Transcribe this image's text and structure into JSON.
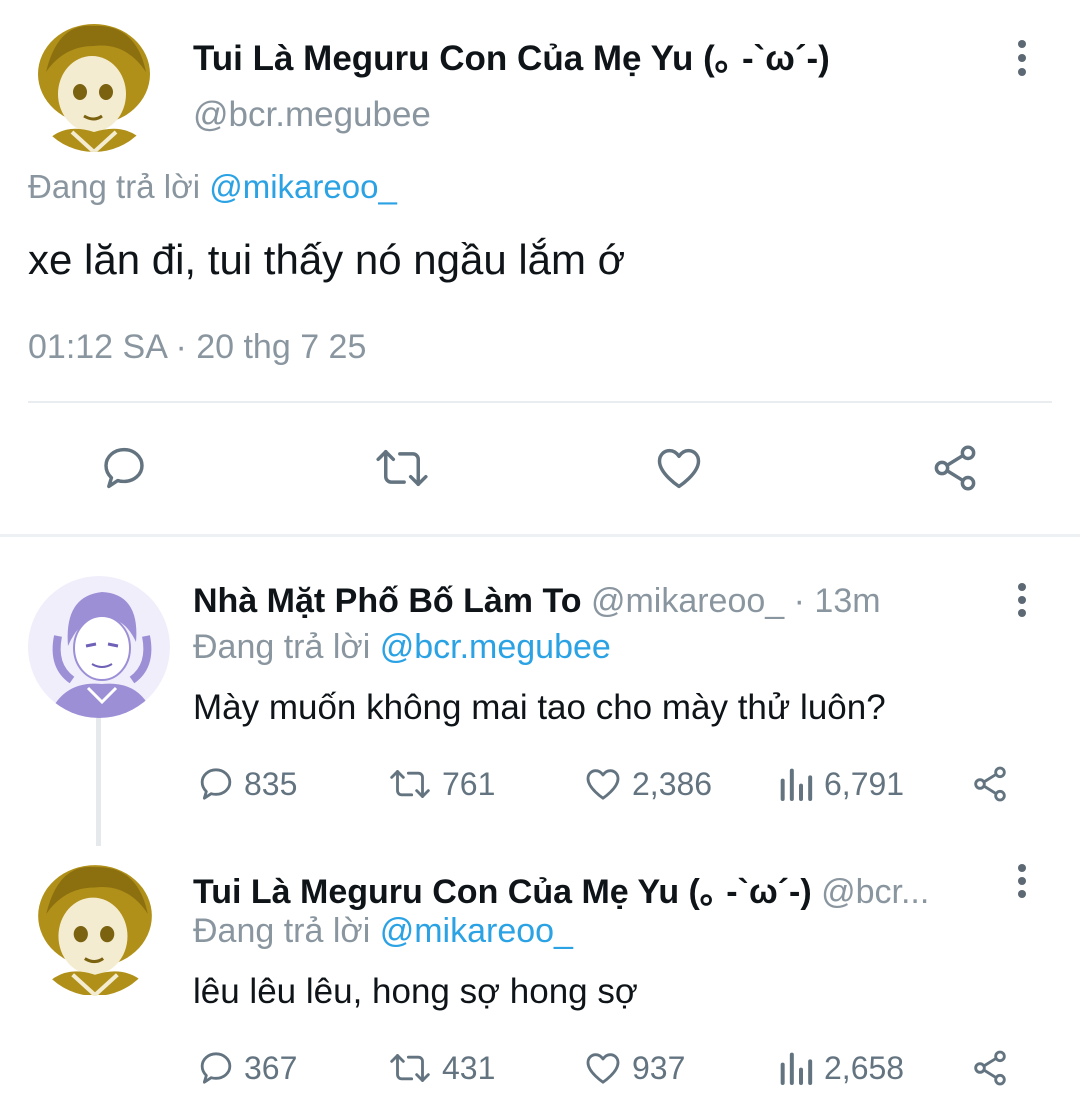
{
  "main_tweet": {
    "display_name": "Tui Là Meguru Con Của Mẹ Yu (｡ -`ω´-)",
    "handle": "@bcr.megubee",
    "replying_prefix": "Đang trả lời ",
    "replying_to": "@mikareoo_",
    "text": "xe lăn đi, tui thấy nó ngầu lắm ớ",
    "timestamp": "01:12 SA · 20 thg 7 25",
    "actions": [
      "reply-icon",
      "retweet-icon",
      "like-icon",
      "share-icon"
    ]
  },
  "replies": [
    {
      "display_name": "Nhà Mặt Phố Bố Làm To",
      "handle_time": "@mikareoo_ · 13m",
      "replying_prefix": "Đang trả lời ",
      "replying_to": "@bcr.megubee",
      "text": "Mày muốn không mai tao cho mày thử luôn?",
      "stats": {
        "replies": "835",
        "retweets": "761",
        "likes": "2,386",
        "views": "6,791"
      }
    },
    {
      "display_name": "Tui Là Meguru Con Của Mẹ Yu (｡ -`ω´-)",
      "handle_time": "@bcr...",
      "replying_prefix": "Đang trả lời ",
      "replying_to": "@mikareoo_",
      "text": "lêu lêu lêu, hong sợ hong sợ",
      "stats": {
        "replies": "367",
        "retweets": "431",
        "likes": "937",
        "views": "2,658"
      }
    }
  ],
  "colors": {
    "link": "#2aa2e4",
    "muted": "#8a969f",
    "avatar_gold": "#b09018",
    "avatar_purple": "#9d8fd6"
  }
}
